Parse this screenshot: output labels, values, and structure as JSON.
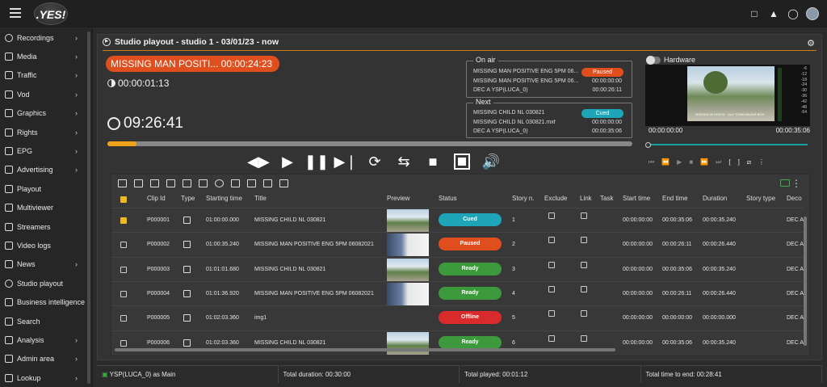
{
  "app": {
    "logo_text": ".YES!"
  },
  "sidebar": {
    "items": [
      {
        "label": "Recordings",
        "chevron": true
      },
      {
        "label": "Media",
        "chevron": true
      },
      {
        "label": "Traffic",
        "chevron": true
      },
      {
        "label": "Vod",
        "chevron": true
      },
      {
        "label": "Graphics",
        "chevron": true
      },
      {
        "label": "Rights",
        "chevron": true
      },
      {
        "label": "EPG",
        "chevron": true
      },
      {
        "label": "Advertising",
        "chevron": true
      },
      {
        "label": "Playout",
        "chevron": false
      },
      {
        "label": "Multiviewer",
        "chevron": false
      },
      {
        "label": "Streamers",
        "chevron": false
      },
      {
        "label": "Video logs",
        "chevron": false
      },
      {
        "label": "News",
        "chevron": true
      },
      {
        "label": "Studio playout",
        "chevron": false
      },
      {
        "label": "Business intelligence",
        "chevron": false
      },
      {
        "label": "Search",
        "chevron": false
      },
      {
        "label": "Analysis",
        "chevron": true
      },
      {
        "label": "Admin area",
        "chevron": true
      },
      {
        "label": "Lookup",
        "chevron": true
      }
    ]
  },
  "panel": {
    "title": "Studio playout - studio 1 - 03/01/23 - now",
    "current_clip": "MISSING MAN POSITI... 00:00:24:23",
    "elapsed": "00:00:01:13",
    "clock": "09:26:41",
    "progress_fraction": 0.055
  },
  "on_air": {
    "legend": "On air",
    "rows": [
      {
        "text": "MISSING MAN POSITIVE ENG 5PM 06...",
        "time": "",
        "pill": "Paused"
      },
      {
        "text": "MISSING MAN POSITIVE ENG 5PM 06...",
        "time": "00:00:00:00"
      },
      {
        "text": "DEC A YSP(LUCA_0)",
        "time": "00:00:26:11"
      }
    ]
  },
  "next": {
    "legend": "Next",
    "rows": [
      {
        "text": "MISSING CHILD NL 030821",
        "time": "",
        "pill": "Cued"
      },
      {
        "text": "MISSING CHILD NL 030821.mxf",
        "time": "00:00:00:00"
      },
      {
        "text": "DEC A YSP(LUCA_0)",
        "time": "00:00:35:06"
      }
    ]
  },
  "hardware": {
    "label": "Hardware",
    "caption": "MISSING IN KENYA · OLD TOWN BAZAR BOX",
    "meter_labels": [
      "-6",
      "-12",
      "-18",
      "-24",
      "-30",
      "-36",
      "-42",
      "-48",
      "-54"
    ],
    "time_start": "00:00:00:00",
    "time_end": "00:00:35:06",
    "transport": [
      "⏮",
      "⏪",
      "▶",
      "■",
      "⏩",
      "⏭",
      "[",
      "]",
      "⧄",
      "⋮"
    ]
  },
  "table": {
    "headers": [
      "Clip Id",
      "Type",
      "Starting time",
      "Title",
      "Preview",
      "Status",
      "Story n.",
      "Exclude",
      "Link",
      "Task",
      "Start time",
      "End time",
      "Duration",
      "Story type",
      "Deco"
    ],
    "rows": [
      {
        "checked": true,
        "clip_id": "P000001",
        "start": "01:00:00.000",
        "title": "MISSING CHILD NL 030821",
        "thumb": "street",
        "status": "Cued",
        "story": "1",
        "start_time": "00:00:00:00",
        "end_time": "00:00:35:06",
        "duration": "00:00:35.240",
        "deco": "DEC A"
      },
      {
        "checked": false,
        "clip_id": "P000002",
        "start": "01:00:35.240",
        "title": "MISSING MAN POSITIVE ENG 5PM  06082021",
        "thumb": "person",
        "status": "Paused",
        "story": "2",
        "start_time": "00:00:00:00",
        "end_time": "00:00:26:11",
        "duration": "00:00:26.440",
        "deco": "DEC A"
      },
      {
        "checked": false,
        "clip_id": "P000003",
        "start": "01:01:01.680",
        "title": "MISSING CHILD NL 030821",
        "thumb": "street",
        "status": "Ready",
        "story": "3",
        "start_time": "00:00:00:00",
        "end_time": "00:00:35:06",
        "duration": "00:00:35.240",
        "deco": "DEC A"
      },
      {
        "checked": false,
        "clip_id": "P000004",
        "start": "01:01:36.920",
        "title": "MISSING MAN POSITIVE ENG 5PM  06082021",
        "thumb": "person",
        "status": "Ready",
        "story": "4",
        "start_time": "00:00:00:00",
        "end_time": "00:00:26:11",
        "duration": "00:00:26.440",
        "deco": "DEC A"
      },
      {
        "checked": false,
        "clip_id": "P000005",
        "start": "01:02:03.360",
        "title": "img1",
        "thumb": "",
        "status": "Offline",
        "story": "5",
        "start_time": "00:00:00:00",
        "end_time": "00:00:00:00",
        "duration": "00:00:00.000",
        "deco": "DEC A"
      },
      {
        "checked": false,
        "clip_id": "P000006",
        "start": "01:02:03.360",
        "title": "MISSING CHILD NL 030821",
        "thumb": "street",
        "status": "Ready",
        "story": "6",
        "start_time": "00:00:00:00",
        "end_time": "00:00:35:06",
        "duration": "00:00:35.240",
        "deco": "DEC A"
      }
    ]
  },
  "footer": {
    "main": "YSP(LUCA_0) as Main",
    "total_duration": "Total duration: 00:30:00",
    "total_played": "Total played: 00:01:12",
    "total_to_end": "Total time to end: 00:28:41"
  }
}
